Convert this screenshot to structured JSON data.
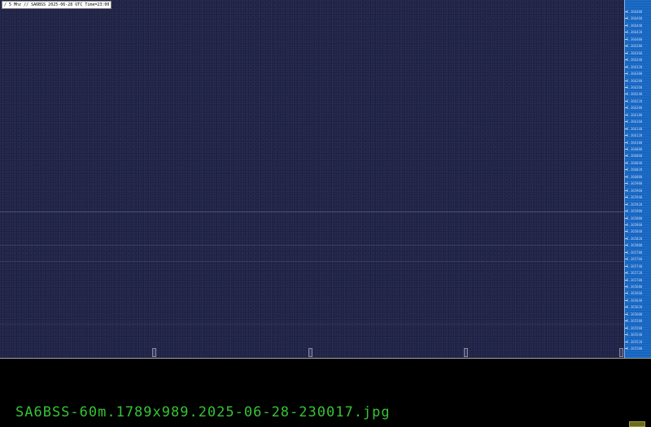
{
  "spectrogram": {
    "title": "/ 5 Mhz // SA6BSS 2025-06-28 UTC Time=23:00",
    "freq_labels": [
      "5.366480",
      "5.366460",
      "5.366440",
      "5.366420",
      "5.366400",
      "5.366380",
      "5.366360",
      "5.366340",
      "5.366320",
      "5.366300",
      "5.366280",
      "5.366260",
      "5.366240",
      "5.366220",
      "5.366200",
      "5.366180",
      "5.366160",
      "5.366140",
      "5.366120",
      "5.366100",
      "5.366080",
      "5.366060",
      "5.366040",
      "5.366020",
      "5.366000",
      "5.365980",
      "5.365960",
      "5.365940",
      "5.365920",
      "5.365900",
      "5.365880",
      "5.365860",
      "5.365840",
      "5.365820",
      "5.365800",
      "5.365780",
      "5.365760",
      "5.365740",
      "5.365720",
      "5.365700",
      "5.365680",
      "5.365660",
      "5.365640",
      "5.365620",
      "5.365600",
      "5.365580",
      "5.365560",
      "5.365540",
      "5.365520",
      "5.365500"
    ],
    "colors": {
      "background": "#1d2148",
      "scale": "#1565c0",
      "scale_text": "#b8d4ff"
    }
  },
  "filename": "SA6BSS-60m.1789x989.2025-06-28-230017.jpg",
  "colors": {
    "filename_text": "#35c435",
    "page_background": "#000000",
    "button": "#6b6b1a"
  }
}
